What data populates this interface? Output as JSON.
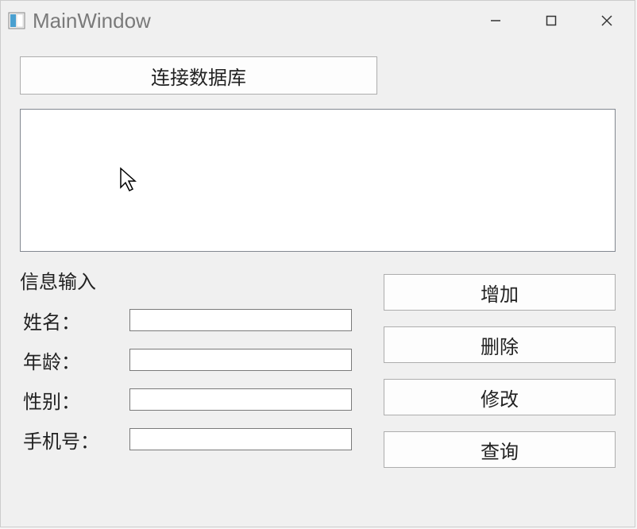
{
  "window": {
    "title": "MainWindow"
  },
  "connect_button_label": "连接数据库",
  "form": {
    "section_title": "信息输入",
    "fields": {
      "name": {
        "label": "姓名：",
        "value": ""
      },
      "age": {
        "label": "年龄：",
        "value": ""
      },
      "gender": {
        "label": "性别：",
        "value": ""
      },
      "phone": {
        "label": "手机号：",
        "value": ""
      }
    }
  },
  "actions": {
    "add": "增加",
    "delete": "删除",
    "update": "修改",
    "query": "查询"
  }
}
